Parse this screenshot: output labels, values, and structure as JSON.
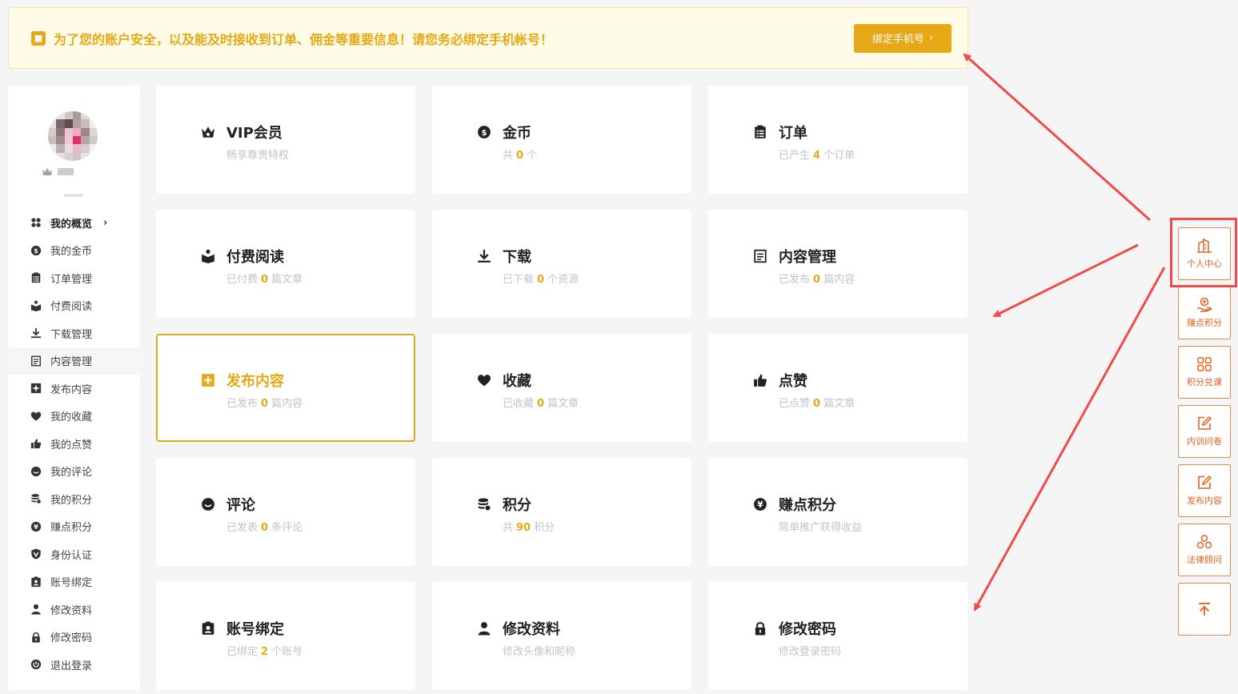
{
  "notice": {
    "text": "为了您的账户安全，以及能及时接收到订单、佣金等重要信息！请您务必绑定手机帐号！",
    "button": "绑定手机号"
  },
  "sidebar": {
    "menu": [
      {
        "label": "我的概览",
        "icon": "grid-icon"
      },
      {
        "label": "我的金币",
        "icon": "coin-icon"
      },
      {
        "label": "订单管理",
        "icon": "order-icon"
      },
      {
        "label": "付费阅读",
        "icon": "reader-icon"
      },
      {
        "label": "下载管理",
        "icon": "download-icon"
      },
      {
        "label": "内容管理",
        "icon": "document-icon"
      },
      {
        "label": "发布内容",
        "icon": "plus-square-icon"
      },
      {
        "label": "我的收藏",
        "icon": "heart-icon"
      },
      {
        "label": "我的点赞",
        "icon": "thumbs-up-icon"
      },
      {
        "label": "我的评论",
        "icon": "comment-icon"
      },
      {
        "label": "我的积分",
        "icon": "coins-stack-icon"
      },
      {
        "label": "赚点积分",
        "icon": "yen-icon"
      },
      {
        "label": "身份认证",
        "icon": "badge-icon"
      },
      {
        "label": "账号绑定",
        "icon": "id-card-icon"
      },
      {
        "label": "修改资料",
        "icon": "user-icon"
      },
      {
        "label": "修改密码",
        "icon": "lock-icon"
      },
      {
        "label": "退出登录",
        "icon": "power-icon"
      }
    ]
  },
  "cards": [
    {
      "title": "VIP会员",
      "pre": "畅享尊贵特权",
      "num": "",
      "post": "",
      "icon": "crown-icon"
    },
    {
      "title": "金币",
      "pre": "共",
      "num": "0",
      "post": "个",
      "icon": "coin-icon"
    },
    {
      "title": "订单",
      "pre": "已产生",
      "num": "4",
      "post": "个订单",
      "icon": "order-icon"
    },
    {
      "title": "付费阅读",
      "pre": "已付费",
      "num": "0",
      "post": "篇文章",
      "icon": "reader-icon"
    },
    {
      "title": "下载",
      "pre": "已下载",
      "num": "0",
      "post": "个资源",
      "icon": "download-icon"
    },
    {
      "title": "内容管理",
      "pre": "已发布",
      "num": "0",
      "post": "篇内容",
      "icon": "document-icon"
    },
    {
      "title": "发布内容",
      "pre": "已发布",
      "num": "0",
      "post": "篇内容",
      "icon": "plus-square-icon"
    },
    {
      "title": "收藏",
      "pre": "已收藏",
      "num": "0",
      "post": "篇文章",
      "icon": "heart-icon"
    },
    {
      "title": "点赞",
      "pre": "已点赞",
      "num": "0",
      "post": "篇文章",
      "icon": "thumbs-up-icon"
    },
    {
      "title": "评论",
      "pre": "已发表",
      "num": "0",
      "post": "条评论",
      "icon": "comment-icon"
    },
    {
      "title": "积分",
      "pre": "共",
      "num": "90",
      "post": "积分",
      "icon": "coins-stack-icon"
    },
    {
      "title": "赚点积分",
      "pre": "简单推广获得收益",
      "num": "",
      "post": "",
      "icon": "yen-icon"
    },
    {
      "title": "账号绑定",
      "pre": "已绑定",
      "num": "2",
      "post": "个账号",
      "icon": "id-card-icon"
    },
    {
      "title": "修改资料",
      "pre": "修改头像和昵称",
      "num": "",
      "post": "",
      "icon": "user-icon"
    },
    {
      "title": "修改密码",
      "pre": "修改登录密码",
      "num": "",
      "post": "",
      "icon": "lock-icon"
    }
  ],
  "toolbar": [
    {
      "label": "个人中心",
      "icon": "building-icon"
    },
    {
      "label": "赚点积分",
      "icon": "hand-coin-icon"
    },
    {
      "label": "积分兑课",
      "icon": "apps-icon"
    },
    {
      "label": "内训问卷",
      "icon": "edit-icon"
    },
    {
      "label": "发布内容",
      "icon": "edit-icon"
    },
    {
      "label": "法律顾问",
      "icon": "cluster-icon"
    },
    {
      "label": "",
      "icon": "back-to-top-icon"
    }
  ],
  "colors": {
    "accent": "#e6a817",
    "annotation": "#ef4b4b",
    "toolbar": "#e8601c"
  }
}
